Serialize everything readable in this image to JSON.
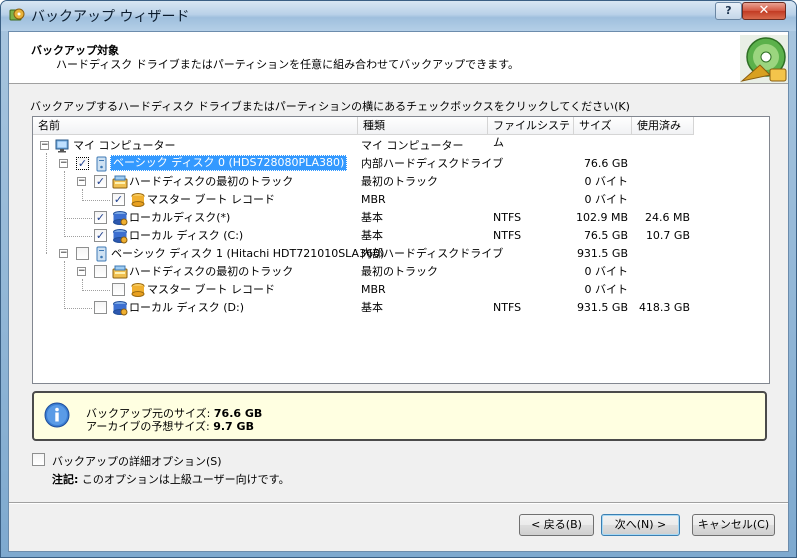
{
  "window": {
    "title": "バックアップ ウィザード",
    "help_label": "?",
    "close_label": "✕"
  },
  "header": {
    "title": "バックアップ対象",
    "subtitle": "ハードディスク ドライブまたはパーティションを任意に組み合わせてバックアップできます。"
  },
  "instruction": "バックアップするハードディスク ドライブまたはパーティションの横にあるチェックボックスをクリックしてください(K)",
  "columns": {
    "name": "名前",
    "type": "種類",
    "fs": "ファイルシステム",
    "size": "サイズ",
    "used": "使用済み"
  },
  "rows": [
    {
      "name": "マイ コンピューター",
      "type": "マイ コンピューター",
      "fs": "",
      "size": "",
      "used": "",
      "checked": null,
      "expanded": true,
      "icon": "computer-icon"
    },
    {
      "name": "ベーシック ディスク 0 (HDS728080PLA380)",
      "type": "内部ハードディスクドライブ",
      "fs": "",
      "size": "76.6 GB",
      "used": "",
      "checked": true,
      "expanded": true,
      "icon": "disk-icon"
    },
    {
      "name": "ハードディスクの最初のトラック",
      "type": "最初のトラック",
      "fs": "",
      "size": "0 バイト",
      "used": "",
      "checked": true,
      "expanded": true,
      "icon": "track-icon"
    },
    {
      "name": "マスター ブート レコード",
      "type": "MBR",
      "fs": "",
      "size": "0 バイト",
      "used": "",
      "checked": true,
      "expanded": null,
      "icon": "mbr-icon"
    },
    {
      "name": "ローカルディスク(*)",
      "type": "基本",
      "fs": "NTFS",
      "size": "102.9 MB",
      "used": "24.6 MB",
      "checked": true,
      "expanded": null,
      "icon": "partition-icon"
    },
    {
      "name": "ローカル ディスク (C:)",
      "type": "基本",
      "fs": "NTFS",
      "size": "76.5 GB",
      "used": "10.7 GB",
      "checked": true,
      "expanded": null,
      "icon": "partition-icon"
    },
    {
      "name": "ベーシック ディスク 1 (Hitachi HDT721010SLA360)",
      "type": "内部ハードディスクドライブ",
      "fs": "",
      "size": "931.5 GB",
      "used": "",
      "checked": false,
      "expanded": true,
      "icon": "disk-icon"
    },
    {
      "name": "ハードディスクの最初のトラック",
      "type": "最初のトラック",
      "fs": "",
      "size": "0 バイト",
      "used": "",
      "checked": false,
      "expanded": true,
      "icon": "track-icon"
    },
    {
      "name": "マスター ブート レコード",
      "type": "MBR",
      "fs": "",
      "size": "0 バイト",
      "used": "",
      "checked": false,
      "expanded": null,
      "icon": "mbr-icon"
    },
    {
      "name": "ローカル ディスク (D:)",
      "type": "基本",
      "fs": "NTFS",
      "size": "931.5 GB",
      "used": "418.3 GB",
      "checked": false,
      "expanded": null,
      "icon": "partition-icon"
    }
  ],
  "summary": {
    "source_label": "バックアップ元のサイズ:",
    "source_value": "76.6 GB",
    "archive_label": "アーカイブの予想サイズ:",
    "archive_value": "9.7 GB"
  },
  "advanced": {
    "label": "バックアップの詳細オプション(S)",
    "checked": false
  },
  "note": {
    "prefix": "注記:",
    "text": " このオプションは上級ユーザー向けです。"
  },
  "buttons": {
    "back": "< 戻る(B)",
    "next": "次へ(N) >",
    "cancel": "キャンセル(C)"
  },
  "colors": {
    "selection": "#3399ff",
    "info_bg": "#ffffe1",
    "title_bar": "#b9d1e8"
  }
}
